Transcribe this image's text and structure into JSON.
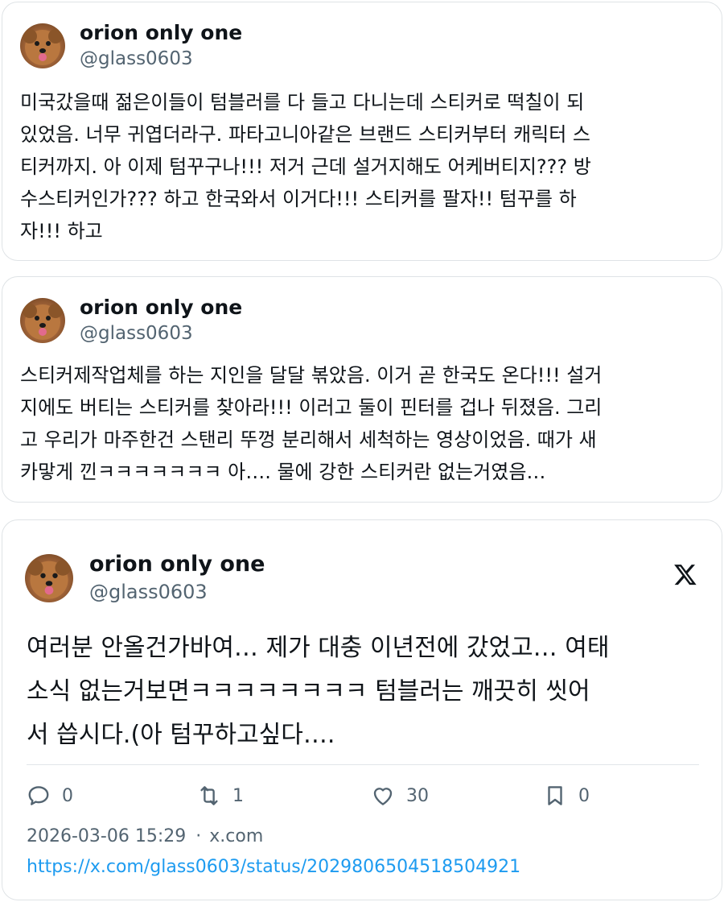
{
  "tweets": [
    {
      "name": "orion only one",
      "handle": "@glass0603",
      "text": "미국갔을때 젊은이들이 텀블러를 다 들고 다니는데 스티커로 떡칠이 되\n있었음. 너무 귀엽더라구. 파타고니아같은 브랜드 스티커부터 캐릭터 스\n티커까지. 아 이제 텀꾸구나!!! 저거 근데 설거지해도 어케버티지??? 방\n수스티커인가??? 하고 한국와서 이거다!!! 스티커를 팔자!! 텀꾸를 하\n자!!! 하고"
    },
    {
      "name": "orion only one",
      "handle": "@glass0603",
      "text": "스티커제작업체를 하는 지인을 달달 볶았음. 이거 곧 한국도 온다!!! 설거\n지에도 버티는 스티커를 찾아라!!! 이러고 둘이 핀터를 겁나 뒤졌음. 그리\n고 우리가 마주한건 스탠리 뚜껑 분리해서 세척하는 영상이었음. 때가 새\n카맣게 낀ㅋㅋㅋㅋㅋㅋㅋ 아…. 물에 강한 스티커란 없는거였음…"
    },
    {
      "name": "orion only one",
      "handle": "@glass0603",
      "text": "여러분 안올건가바여… 제가 대충 이년전에 갔었고… 여태\n소식 없는거보면ㅋㅋㅋㅋㅋㅋㅋㅋ 텀블러는 깨끗히 씻어\n서 씁시다.(아 텀꾸하고싶다….",
      "replies": "0",
      "retweets": "1",
      "likes": "30",
      "bookmarks": "0",
      "timestamp": "2026-03-06 15:29",
      "source": "x.com",
      "url": "https://x.com/glass0603/status/2029806504518504921"
    }
  ],
  "icons": {
    "brand": "x-logo-icon",
    "reply": "reply-icon",
    "retweet": "retweet-icon",
    "like": "heart-icon",
    "bookmark": "bookmark-icon"
  },
  "colors": {
    "text": "#0f1419",
    "muted": "#536471",
    "link": "#1d9bf0",
    "border": "#dfe3e6"
  }
}
